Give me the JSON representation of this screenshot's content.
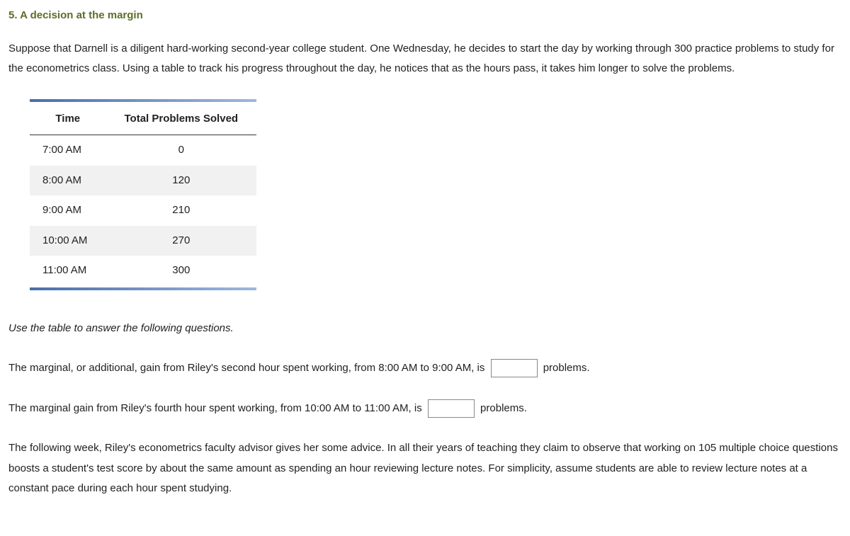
{
  "title": "5. A decision at the margin",
  "intro": "Suppose that Darnell is a diligent hard-working second-year college student. One Wednesday, he decides to start the day by working through 300 practice problems to study for the econometrics class. Using a table to track his progress throughout the day, he notices that as the hours pass, it takes him longer to solve the problems.",
  "table": {
    "headers": {
      "col1": "Time",
      "col2": "Total Problems Solved"
    },
    "rows": [
      {
        "time": "7:00 AM",
        "solved": "0"
      },
      {
        "time": "8:00 AM",
        "solved": "120"
      },
      {
        "time": "9:00 AM",
        "solved": "210"
      },
      {
        "time": "10:00 AM",
        "solved": "270"
      },
      {
        "time": "11:00 AM",
        "solved": "300"
      }
    ]
  },
  "instruction": "Use the table to answer the following questions.",
  "q1": {
    "before": "The marginal, or additional, gain from Riley's second hour spent working, from 8:00 AM to 9:00 AM, is",
    "after": "problems."
  },
  "q2": {
    "before": "The marginal gain from Riley's fourth hour spent working, from 10:00 AM to 11:00 AM, is",
    "after": "problems."
  },
  "followup": "The following week, Riley's econometrics faculty advisor gives her some advice. In all their years of teaching they claim to observe that working on 105 multiple choice questions boosts a student's test score by about the same amount as spending an hour reviewing lecture notes. For simplicity, assume students are able to review lecture notes at a constant pace during each hour spent studying."
}
